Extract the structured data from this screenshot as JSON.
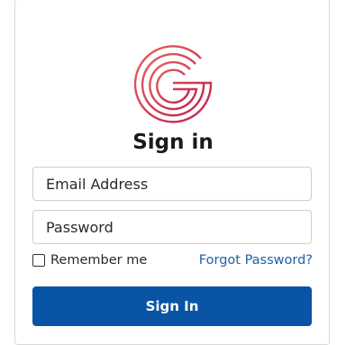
{
  "brand": {
    "logo_icon": "g-ring-logo-icon",
    "logo_color_start": "#e35a5a",
    "logo_color_end": "#c8234a"
  },
  "form": {
    "title": "Sign in",
    "email_placeholder": "Email Address",
    "password_placeholder": "Password",
    "remember_label": "Remember me",
    "remember_checked": false,
    "forgot_label": "Forgot Password?",
    "submit_label": "Sign In"
  },
  "colors": {
    "primary_button": "#0a54a5",
    "link": "#1d5fa8"
  }
}
